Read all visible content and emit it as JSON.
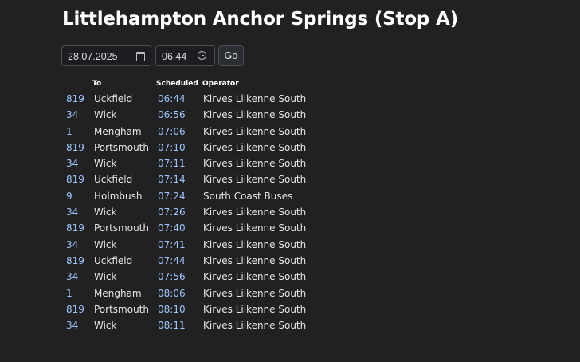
{
  "page": {
    "title": "Littlehampton Anchor Springs (Stop A)"
  },
  "controls": {
    "date_value": "28.07.2025",
    "time_value": "06.44",
    "go_label": "Go"
  },
  "table": {
    "headers": {
      "route": "",
      "to": "To",
      "scheduled": "Scheduled",
      "operator": "Operator"
    },
    "rows": [
      {
        "route": "819",
        "to": "Uckfield",
        "scheduled": "06:44",
        "operator": "Kirves Liikenne South"
      },
      {
        "route": "34",
        "to": "Wick",
        "scheduled": "06:56",
        "operator": "Kirves Liikenne South"
      },
      {
        "route": "1",
        "to": "Mengham",
        "scheduled": "07:06",
        "operator": "Kirves Liikenne South"
      },
      {
        "route": "819",
        "to": "Portsmouth",
        "scheduled": "07:10",
        "operator": "Kirves Liikenne South"
      },
      {
        "route": "34",
        "to": "Wick",
        "scheduled": "07:11",
        "operator": "Kirves Liikenne South"
      },
      {
        "route": "819",
        "to": "Uckfield",
        "scheduled": "07:14",
        "operator": "Kirves Liikenne South"
      },
      {
        "route": "9",
        "to": "Holmbush",
        "scheduled": "07:24",
        "operator": "South Coast Buses"
      },
      {
        "route": "34",
        "to": "Wick",
        "scheduled": "07:26",
        "operator": "Kirves Liikenne South"
      },
      {
        "route": "819",
        "to": "Portsmouth",
        "scheduled": "07:40",
        "operator": "Kirves Liikenne South"
      },
      {
        "route": "34",
        "to": "Wick",
        "scheduled": "07:41",
        "operator": "Kirves Liikenne South"
      },
      {
        "route": "819",
        "to": "Uckfield",
        "scheduled": "07:44",
        "operator": "Kirves Liikenne South"
      },
      {
        "route": "34",
        "to": "Wick",
        "scheduled": "07:56",
        "operator": "Kirves Liikenne South"
      },
      {
        "route": "1",
        "to": "Mengham",
        "scheduled": "08:06",
        "operator": "Kirves Liikenne South"
      },
      {
        "route": "819",
        "to": "Portsmouth",
        "scheduled": "08:10",
        "operator": "Kirves Liikenne South"
      },
      {
        "route": "34",
        "to": "Wick",
        "scheduled": "08:11",
        "operator": "Kirves Liikenne South"
      }
    ]
  },
  "icons": {
    "date_picker": "calendar-icon",
    "time_picker": "clock-icon"
  },
  "colors": {
    "background": "#212121",
    "link": "#9ec5fe",
    "text": "#e6e6e6"
  }
}
